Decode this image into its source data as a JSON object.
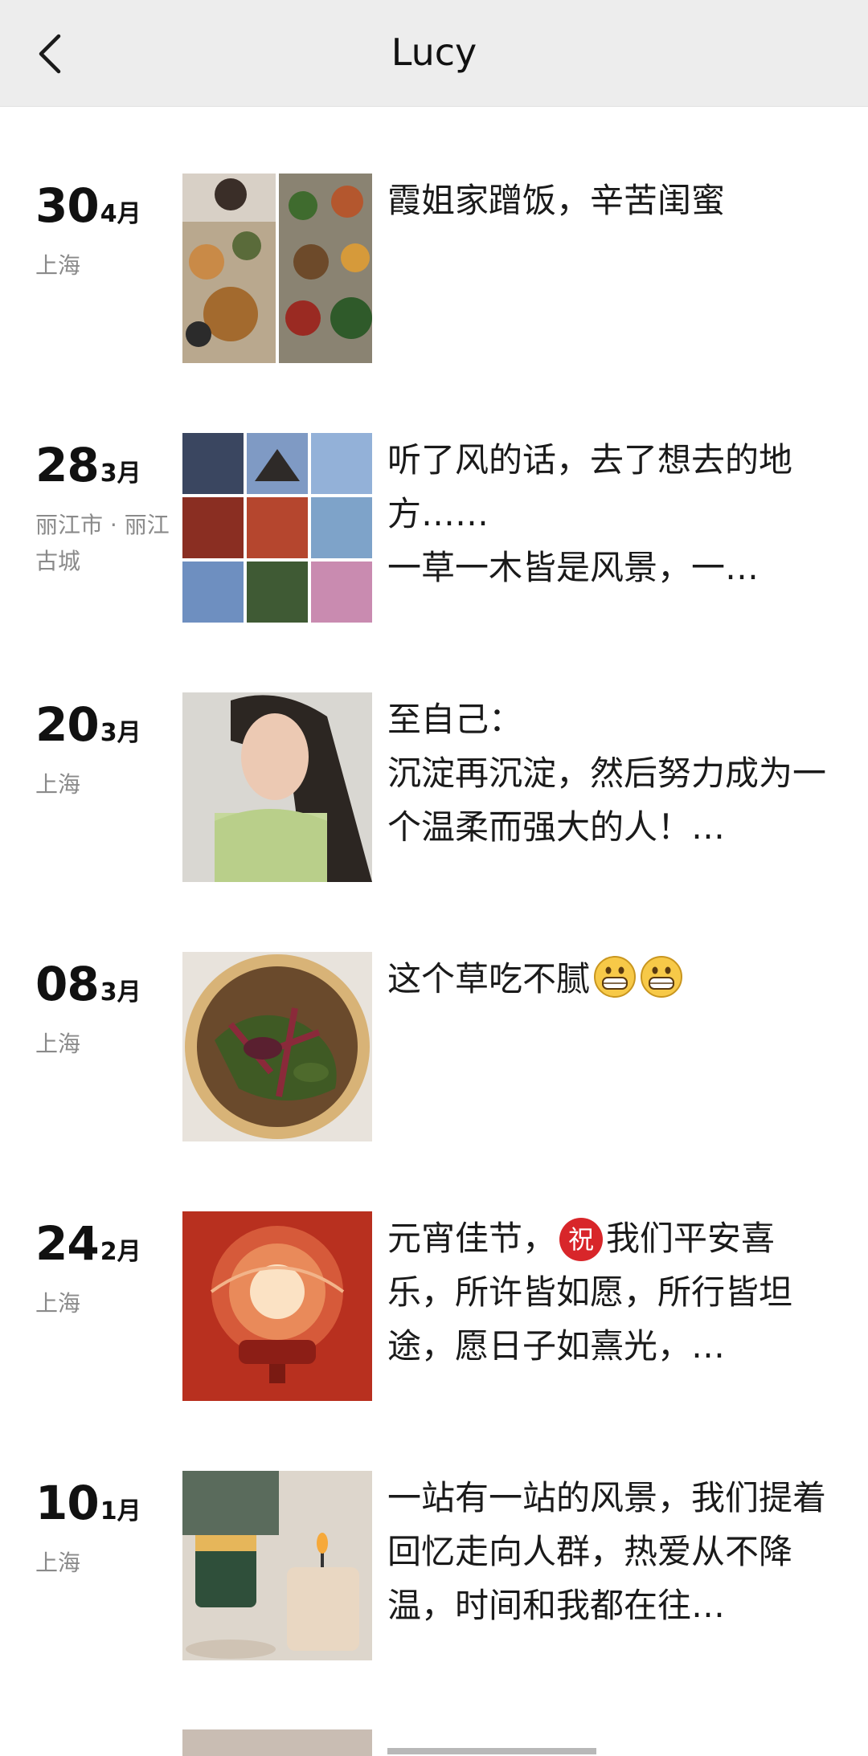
{
  "header": {
    "title": "Lucy"
  },
  "posts": [
    {
      "day": "30",
      "month": "4月",
      "location": "上海",
      "text": "霞姐家蹭饭，辛苦闺蜜"
    },
    {
      "day": "28",
      "month": "3月",
      "location": "丽江市 · 丽江古城",
      "text": "听了风的话，去了想去的地方……\n一草一木皆是风景，一…"
    },
    {
      "day": "20",
      "month": "3月",
      "location": "上海",
      "text": "至自己：\n沉淀再沉淀，然后努力成为一个温柔而强大的人！…"
    },
    {
      "day": "08",
      "month": "3月",
      "location": "上海",
      "text": "这个草吃不腻"
    },
    {
      "day": "24",
      "month": "2月",
      "location": "上海",
      "text_before": "元宵佳节，",
      "badge": "祝",
      "text_after": "我们平安喜乐，所许皆如愿，所行皆坦途，愿日子如熹光，…"
    },
    {
      "day": "10",
      "month": "1月",
      "location": "上海",
      "text": "一站有一站的风景，我们提着回忆走向人群，热爱从不降温，时间和我都在往…"
    }
  ],
  "icons": {
    "back": "chevron-left-icon",
    "grin_emoji": "grinning-face-icon"
  },
  "colors": {
    "header_bg": "#ededed",
    "location_text": "#8a8a8a",
    "badge_red": "#d8262a"
  }
}
